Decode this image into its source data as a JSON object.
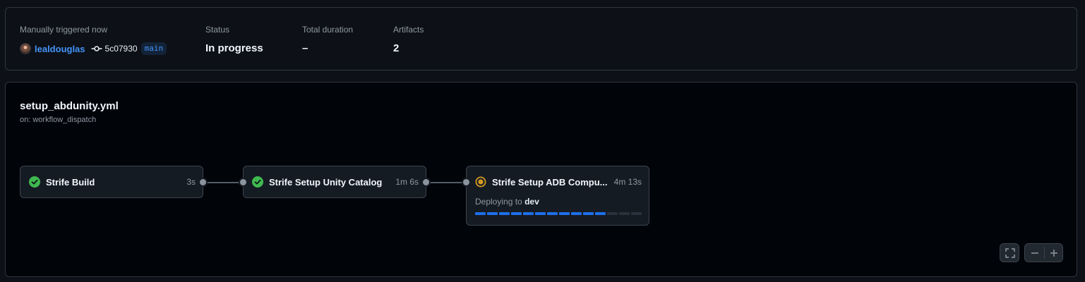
{
  "summary": {
    "trigger_label": "Manually triggered now",
    "actor": "lealdouglas",
    "commit_sha": "5c07930",
    "branch": "main",
    "status_label": "Status",
    "status_value": "In progress",
    "duration_label": "Total duration",
    "duration_value": "–",
    "artifacts_label": "Artifacts",
    "artifacts_value": "2"
  },
  "workflow": {
    "file": "setup_abdunity.yml",
    "trigger": "on: workflow_dispatch"
  },
  "jobs": [
    {
      "name": "Strife Build",
      "duration": "3s",
      "status": "success",
      "status_icon": "check-circle-fill-icon"
    },
    {
      "name": "Strife Setup Unity Catalog",
      "duration": "1m 6s",
      "status": "success",
      "status_icon": "check-circle-fill-icon"
    },
    {
      "name": "Strife Setup ADB Compu...",
      "duration": "4m 13s",
      "status": "in_progress",
      "status_icon": "dot-fill-icon",
      "deploy_prefix": "Deploying to",
      "environment": "dev",
      "progress_segments_total": 14,
      "progress_segments_done": 11
    }
  ],
  "controls": {
    "fullscreen_icon": "screen-full-icon",
    "zoom_out_icon": "dash-icon",
    "zoom_in_icon": "plus-icon"
  },
  "colors": {
    "success": "#3fb950",
    "in_progress": "#d29922",
    "accent": "#4493f8",
    "progress": "#1f6feb"
  }
}
